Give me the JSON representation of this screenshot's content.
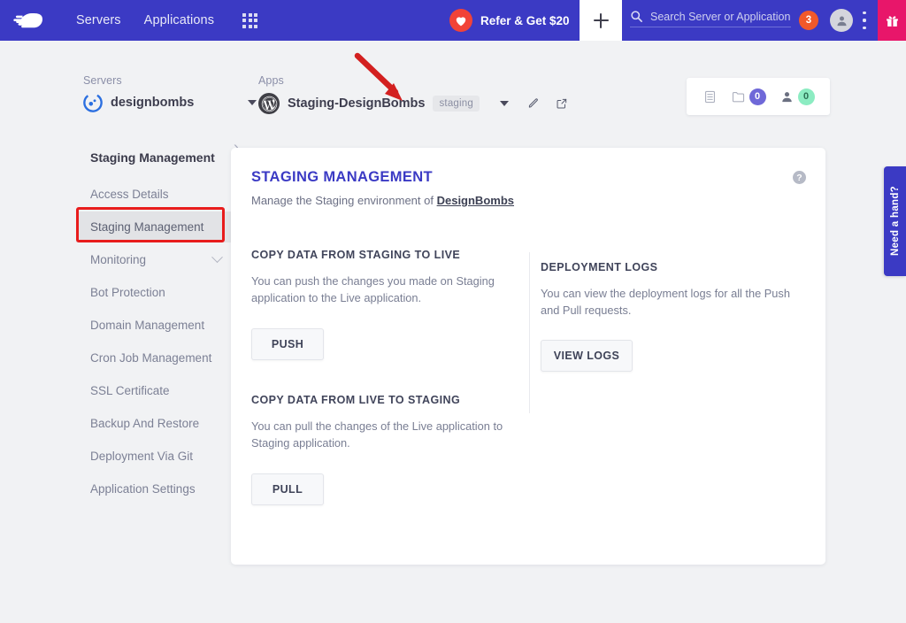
{
  "topbar": {
    "nav": [
      {
        "label": "Servers",
        "name": "nav-servers"
      },
      {
        "label": "Applications",
        "name": "nav-applications"
      }
    ],
    "grid_icon": "apps-grid-icon",
    "refer_label": "Refer & Get $20",
    "heart_icon": "heart-icon",
    "plus_icon": "plus-icon",
    "search_placeholder": "Search Server or Application",
    "search_icon": "search-icon",
    "notification_count": "3",
    "avatar_icon": "user-avatar-icon",
    "kebab_icon": "more-vertical-icon",
    "gift_icon": "gift-icon",
    "brand_color": "#3b3ac4",
    "accent_pink": "#e8166a",
    "accent_orange": "#f1592a"
  },
  "breadcrumb": {
    "servers_label": "Servers",
    "server_name": "designbombs",
    "server_icon": "cloudways-server-icon",
    "separator": "›",
    "apps_label": "Apps",
    "app_name": "Staging-DesignBombs",
    "app_icon": "wordpress-icon",
    "staging_badge": "staging",
    "dropdown_icon": "caret-down-icon",
    "edit_icon": "pencil-icon",
    "external_icon": "external-link-icon"
  },
  "stats": [
    {
      "name": "server-list-icon",
      "icon": "server-stack-icon",
      "value": null
    },
    {
      "name": "folder-count",
      "icon": "folder-icon",
      "value": "0",
      "color": "#6f68d8"
    },
    {
      "name": "user-count",
      "icon": "user-icon",
      "value": "0",
      "color": "#8cecc2"
    }
  ],
  "sidebar": {
    "title": "Staging Management",
    "items": [
      {
        "label": "Access Details",
        "name": "sidebar-item-access-details",
        "active": false,
        "chevron": false
      },
      {
        "label": "Staging Management",
        "name": "sidebar-item-staging-management",
        "active": true,
        "chevron": false
      },
      {
        "label": "Monitoring",
        "name": "sidebar-item-monitoring",
        "active": false,
        "chevron": true
      },
      {
        "label": "Bot Protection",
        "name": "sidebar-item-bot-protection",
        "active": false,
        "chevron": false
      },
      {
        "label": "Domain Management",
        "name": "sidebar-item-domain-management",
        "active": false,
        "chevron": false
      },
      {
        "label": "Cron Job Management",
        "name": "sidebar-item-cron-job-management",
        "active": false,
        "chevron": false
      },
      {
        "label": "SSL Certificate",
        "name": "sidebar-item-ssl-certificate",
        "active": false,
        "chevron": false
      },
      {
        "label": "Backup And Restore",
        "name": "sidebar-item-backup-and-restore",
        "active": false,
        "chevron": false
      },
      {
        "label": "Deployment Via Git",
        "name": "sidebar-item-deployment-via-git",
        "active": false,
        "chevron": false
      },
      {
        "label": "Application Settings",
        "name": "sidebar-item-application-settings",
        "active": false,
        "chevron": false
      }
    ]
  },
  "main": {
    "title": "STAGING MANAGEMENT",
    "subtitle_prefix": "Manage the Staging environment of ",
    "subtitle_link": "DesignBombs",
    "help_icon": "help-question-icon",
    "sections": {
      "push": {
        "heading": "COPY DATA FROM STAGING TO LIVE",
        "body": "You can push the changes you made on Staging application to the Live application.",
        "button": "PUSH"
      },
      "pull": {
        "heading": "COPY DATA FROM LIVE TO STAGING",
        "body": "You can pull the changes of the Live application to Staging application.",
        "button": "PULL"
      },
      "logs": {
        "heading": "DEPLOYMENT LOGS",
        "body": "You can view the deployment logs for all the Push and Pull requests.",
        "button": "VIEW LOGS"
      }
    }
  },
  "support_tab": {
    "label": "Need a hand?"
  },
  "annotations": {
    "arrow_color": "#d32020",
    "highlight_color": "#e81c1c"
  }
}
